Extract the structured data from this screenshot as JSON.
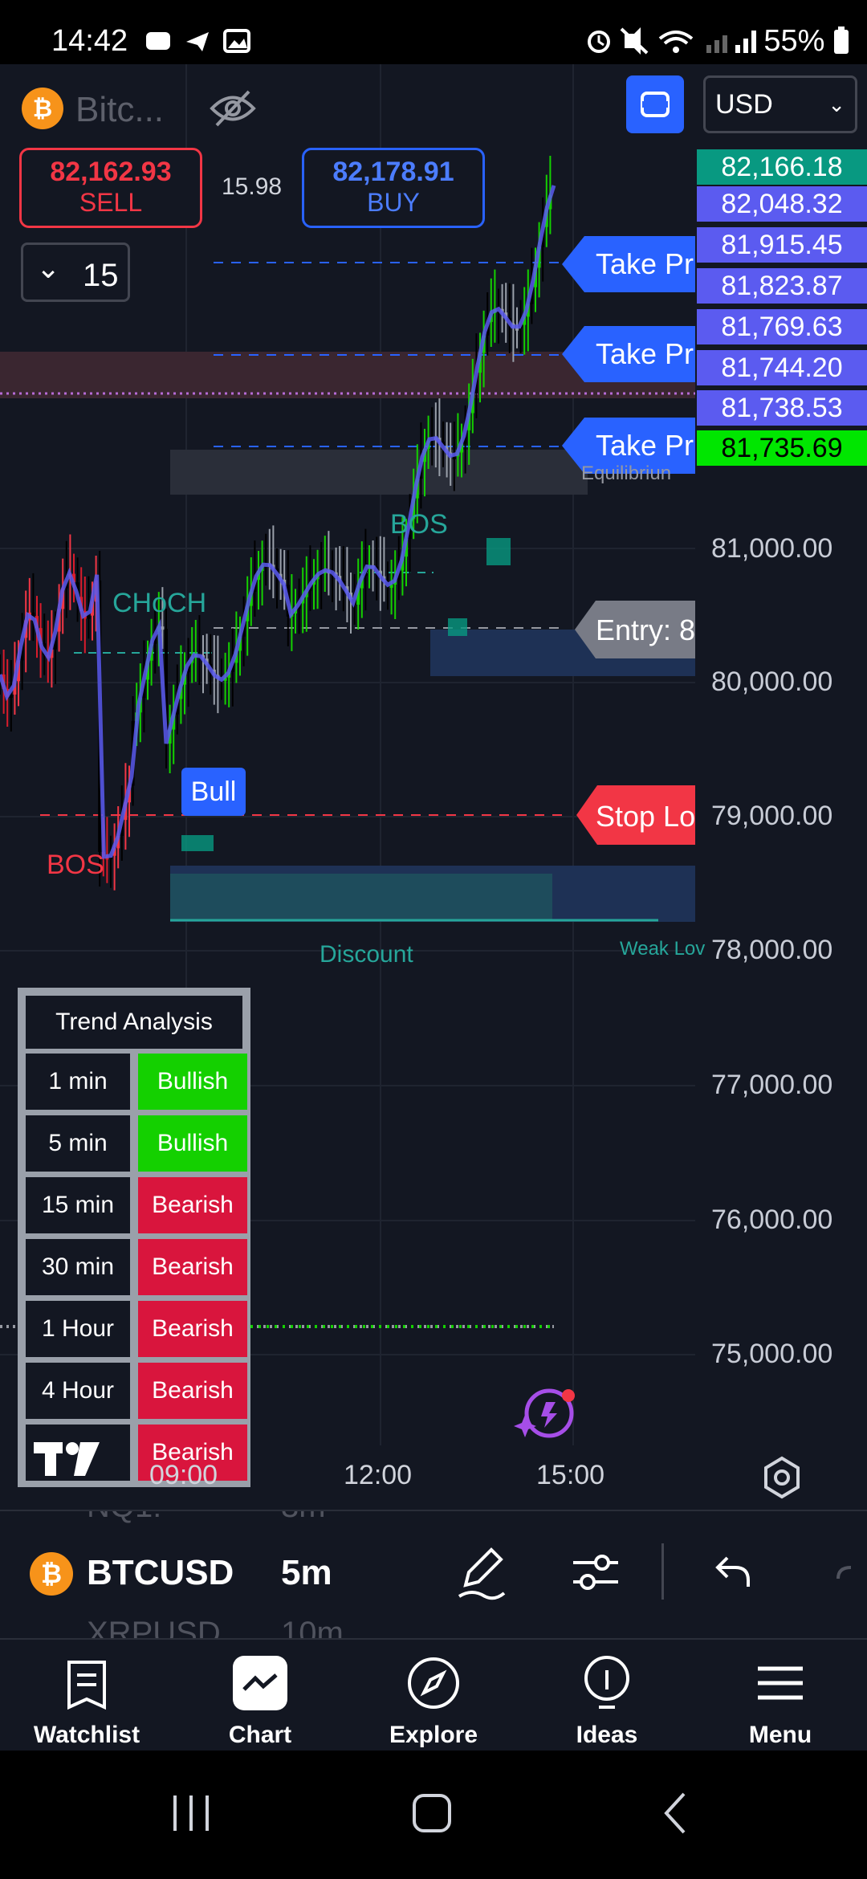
{
  "status_bar": {
    "time": "14:42",
    "battery": "55%"
  },
  "chart_header": {
    "symbol_short": "Bitc...",
    "currency": "USD",
    "sell": {
      "price": "82,162.93",
      "label": "SELL"
    },
    "spread": "15.98",
    "buy": {
      "price": "82,178.91",
      "label": "BUY"
    },
    "quantity": "15"
  },
  "price_labels": [
    {
      "value": "82,166.18",
      "color": "#089981"
    },
    {
      "value": "82,048.32",
      "color": "#5b5bf0"
    },
    {
      "value": "81,915.45",
      "color": "#5b5bf0"
    },
    {
      "value": "81,823.87",
      "color": "#5b5bf0"
    },
    {
      "value": "81,769.63",
      "color": "#5b5bf0"
    },
    {
      "value": "81,744.20",
      "color": "#5b5bf0"
    },
    {
      "value": "81,738.53",
      "color": "#5b5bf0"
    },
    {
      "value": "81,735.69",
      "color": "#00e600"
    }
  ],
  "axis": {
    "y_ticks": [
      "81,000.00",
      "80,000.00",
      "79,000.00",
      "78,000.00",
      "77,000.00",
      "76,000.00",
      "75,000.00"
    ],
    "x_ticks": [
      "09:00",
      "12:00",
      "15:00"
    ]
  },
  "annotations": {
    "take_profit": "Take Pr",
    "take_profit_2": "Take Pr",
    "take_profit_3": "Take Pr",
    "entry": "Entry: 8",
    "stop_loss": "Stop Lo",
    "bos_top": "BOS",
    "choch": "CHoCH",
    "bos_bottom": "BOS",
    "bull": "Bull",
    "discount": "Discount",
    "weak_low": "Weak Lov",
    "equilibrium": "Equilibriun"
  },
  "trend_analysis": {
    "title": "Trend Analysis",
    "rows": [
      {
        "tf": "1 min",
        "state": "Bullish",
        "color": "#14d000"
      },
      {
        "tf": "5 min",
        "state": "Bullish",
        "color": "#14d000"
      },
      {
        "tf": "15 min",
        "state": "Bearish",
        "color": "#d9153d"
      },
      {
        "tf": "30 min",
        "state": "Bearish",
        "color": "#d9153d"
      },
      {
        "tf": "1 Hour",
        "state": "Bearish",
        "color": "#d9153d"
      },
      {
        "tf": "4 Hour",
        "state": "Bearish",
        "color": "#d9153d"
      },
      {
        "tf": "",
        "state": "Bearish",
        "color": "#d9153d"
      }
    ]
  },
  "bottom_toolbar": {
    "symbol": "BTCUSD",
    "interval": "5m",
    "prev_symbol": "NQ1!",
    "prev_interval": "3m",
    "next_symbol": "XRPUSD",
    "next_interval": "10m"
  },
  "nav": [
    {
      "label": "Watchlist",
      "icon": "watchlist-icon"
    },
    {
      "label": "Chart",
      "icon": "chart-icon"
    },
    {
      "label": "Explore",
      "icon": "compass-icon"
    },
    {
      "label": "Ideas",
      "icon": "lightbulb-icon"
    },
    {
      "label": "Menu",
      "icon": "menu-icon"
    }
  ]
}
